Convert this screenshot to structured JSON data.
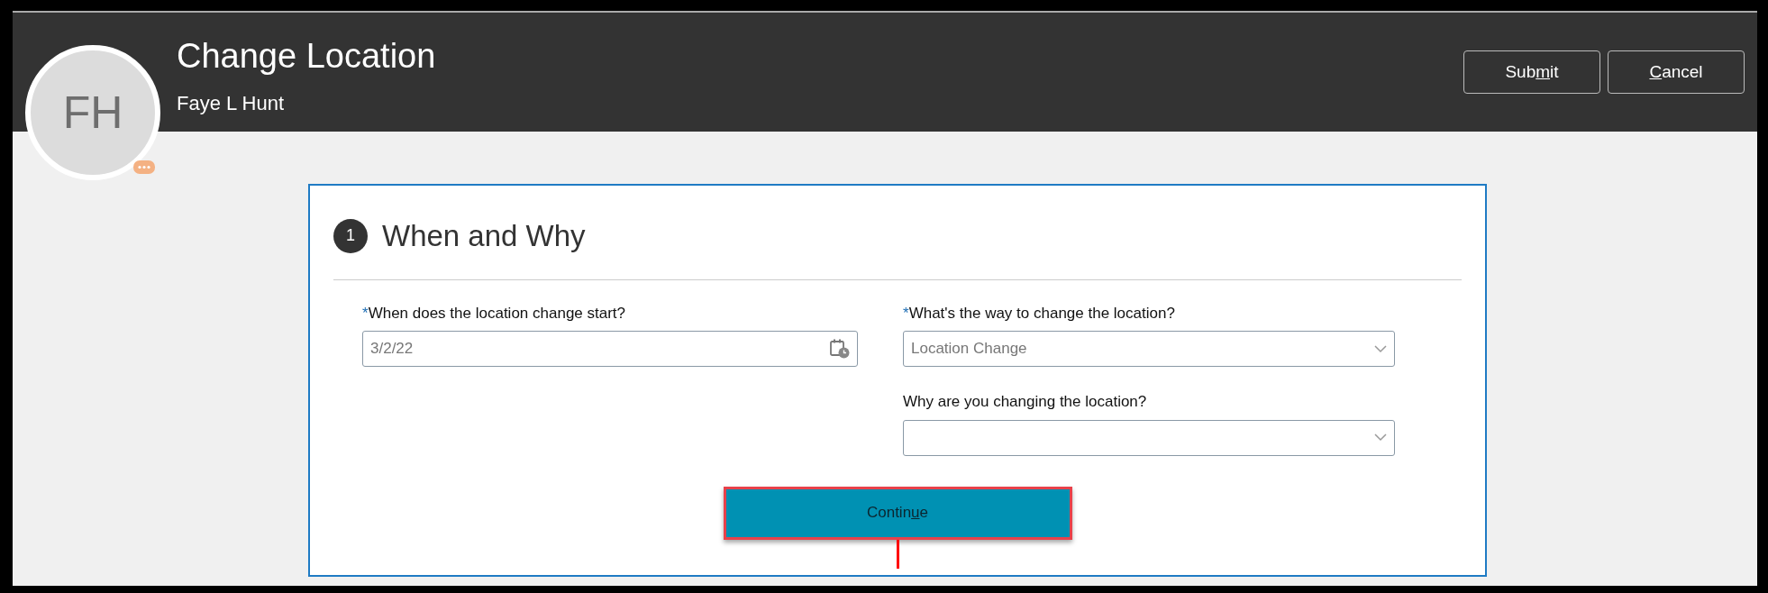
{
  "header": {
    "title": "Change Location",
    "subtitle": "Faye L Hunt",
    "avatar": {
      "initials": "FH"
    },
    "buttons": [
      {
        "label_before": "Sub",
        "access_key": "m",
        "label_after": "it"
      },
      {
        "access_key": "C",
        "label_after": "ancel"
      }
    ]
  },
  "section": {
    "step": "1",
    "title": "When and Why"
  },
  "columns": [
    {
      "fields": [
        {
          "kind": "date",
          "required_mark": "*",
          "label": "When does the location change start?",
          "value": "3/2/22"
        }
      ]
    },
    {
      "fields": [
        {
          "kind": "select",
          "required_mark": "*",
          "label": "What's the way to change the location?",
          "value": "Location Change"
        },
        {
          "kind": "select",
          "label": "Why are you changing the location?"
        }
      ]
    }
  ],
  "continue_button": {
    "label_before": "Contin",
    "access_key": "u",
    "label_after": "e",
    "highlighted": true
  }
}
